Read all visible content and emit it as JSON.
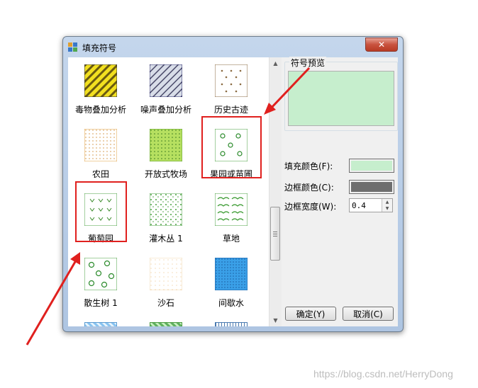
{
  "window": {
    "title": "填充符号",
    "close_glyph": "✕"
  },
  "symbols": [
    {
      "label": "毒物叠加分析",
      "pattern": "yellow-diagonal"
    },
    {
      "label": "噪声叠加分析",
      "pattern": "gray-diagonal"
    },
    {
      "label": "历史古迹",
      "pattern": "triangles"
    },
    {
      "label": "农田",
      "pattern": "orange-dots"
    },
    {
      "label": "开放式牧场",
      "pattern": "green-dots"
    },
    {
      "label": "果园或苗圃",
      "pattern": "orchard"
    },
    {
      "label": "葡萄园",
      "pattern": "vineyard"
    },
    {
      "label": "灌木丛 1",
      "pattern": "shrub"
    },
    {
      "label": "草地",
      "pattern": "grass"
    },
    {
      "label": "散生树 1",
      "pattern": "trees"
    },
    {
      "label": "沙石",
      "pattern": "sand"
    },
    {
      "label": "间歇水",
      "pattern": "water"
    }
  ],
  "preview": {
    "group_label": "符号预览",
    "color": "#c6eecd"
  },
  "fill_color": {
    "label": "填充颜色(F):",
    "value": "#c6eecd"
  },
  "border_color": {
    "label": "边框颜色(C):",
    "value": "#6e6e6e"
  },
  "border_width": {
    "label": "边框宽度(W):",
    "value": "0.4"
  },
  "buttons": {
    "ok": "确定(Y)",
    "cancel": "取消(C)"
  },
  "watermark": "https://blog.csdn.net/HerryDong"
}
